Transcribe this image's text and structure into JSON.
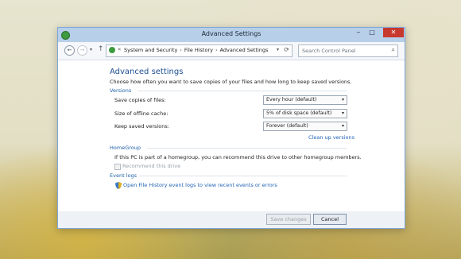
{
  "window": {
    "title": "Advanced Settings",
    "controls": {
      "minimize": "‒",
      "maximize": "□",
      "close": "✕"
    }
  },
  "nav": {
    "back_glyph": "←",
    "forward_glyph": "→",
    "recent_glyph": "▾",
    "up_glyph": "↑",
    "address": {
      "chevron": "«",
      "crumbs": [
        "System and Security",
        "File History",
        "Advanced Settings"
      ],
      "separator": "›",
      "dropdown_glyph": "▾",
      "refresh_glyph": "⟳"
    },
    "search": {
      "placeholder": "Search Control Panel",
      "icon_glyph": "⌕"
    }
  },
  "main": {
    "heading": "Advanced settings",
    "description": "Choose how often you want to save copies of your files and how long to keep saved versions.",
    "versions": {
      "label": "Versions",
      "rows": [
        {
          "label": "Save copies of files:",
          "value": "Every hour (default)"
        },
        {
          "label": "Size of offline cache:",
          "value": "5% of disk space (default)"
        },
        {
          "label": "Keep saved versions:",
          "value": "Forever (default)"
        }
      ],
      "cleanup_link": "Clean up versions"
    },
    "homegroup": {
      "label": "HomeGroup",
      "text": "If this PC is part of a homegroup, you can recommend this drive to other homegroup members.",
      "checkbox_label": "Recommend this drive",
      "checked": false
    },
    "eventlogs": {
      "label": "Event logs",
      "link": "Open File History event logs to view recent events or errors"
    },
    "select_arrow": "▾"
  },
  "footer": {
    "save_label": "Save changes",
    "cancel_label": "Cancel"
  },
  "colors": {
    "accent": "#1d4f91",
    "link": "#1f63b6",
    "close_button": "#c7392e"
  }
}
